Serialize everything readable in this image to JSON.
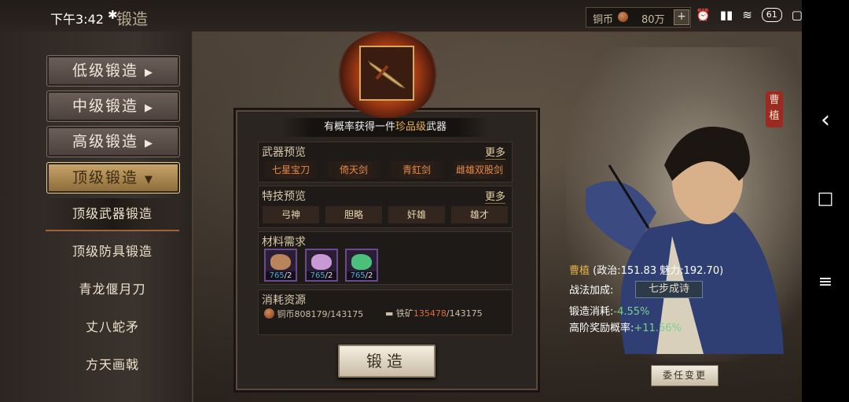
{
  "status": {
    "time": "下午3:42",
    "bluetooth": "✱",
    "title_ghost": "锻造",
    "battery": "61"
  },
  "currency": {
    "label": "铜币",
    "amount": "80万",
    "plus": "+"
  },
  "menu": [
    {
      "label": "低级锻造",
      "arrow": "▶"
    },
    {
      "label": "中级锻造",
      "arrow": "▶"
    },
    {
      "label": "高级锻造",
      "arrow": "▶"
    },
    {
      "label": "顶级锻造",
      "arrow": "▼"
    }
  ],
  "submenu": [
    "顶级武器锻造",
    "顶级防具锻造",
    "青龙偃月刀",
    "丈八蛇矛",
    "方天画戟"
  ],
  "banner": {
    "prefix": "有概率获得一件",
    "highlight": "珍品级",
    "suffix": "武器"
  },
  "weapons": {
    "title": "武器预览",
    "more": "更多",
    "items": [
      "七星宝刀",
      "倚天剑",
      "青釭剑",
      "雌雄双股剑"
    ]
  },
  "skills": {
    "title": "特技预览",
    "more": "更多",
    "items": [
      "弓神",
      "胆略",
      "奸雄",
      "雄才"
    ]
  },
  "materials": {
    "title": "材料需求",
    "items": [
      {
        "have": "765",
        "need": "2",
        "color": "#b8845a"
      },
      {
        "have": "765",
        "need": "2",
        "color": "#c79ad6"
      },
      {
        "have": "765",
        "need": "2",
        "color": "#4ac07a"
      }
    ]
  },
  "costs": {
    "title": "消耗资源",
    "copper": {
      "label": "铜币",
      "have": "808179",
      "need": "143175"
    },
    "iron": {
      "label": "铁矿",
      "have": "135478",
      "need": "143175"
    }
  },
  "forge_button": "锻造",
  "hero": {
    "seal": "曹植",
    "name": "曹植",
    "stats": "(政治:151.83 魅力:192.70)",
    "tactic_label": "战法加成:",
    "tactic": "七步成诗",
    "cost_label": "锻造消耗:",
    "cost_value": "-4.55%",
    "reward_label": "高阶奖励概率:",
    "reward_value": "+11.56%"
  },
  "assign_button": "委任变更",
  "nav": {
    "back": "‹",
    "home": "□",
    "menu": "≡"
  }
}
